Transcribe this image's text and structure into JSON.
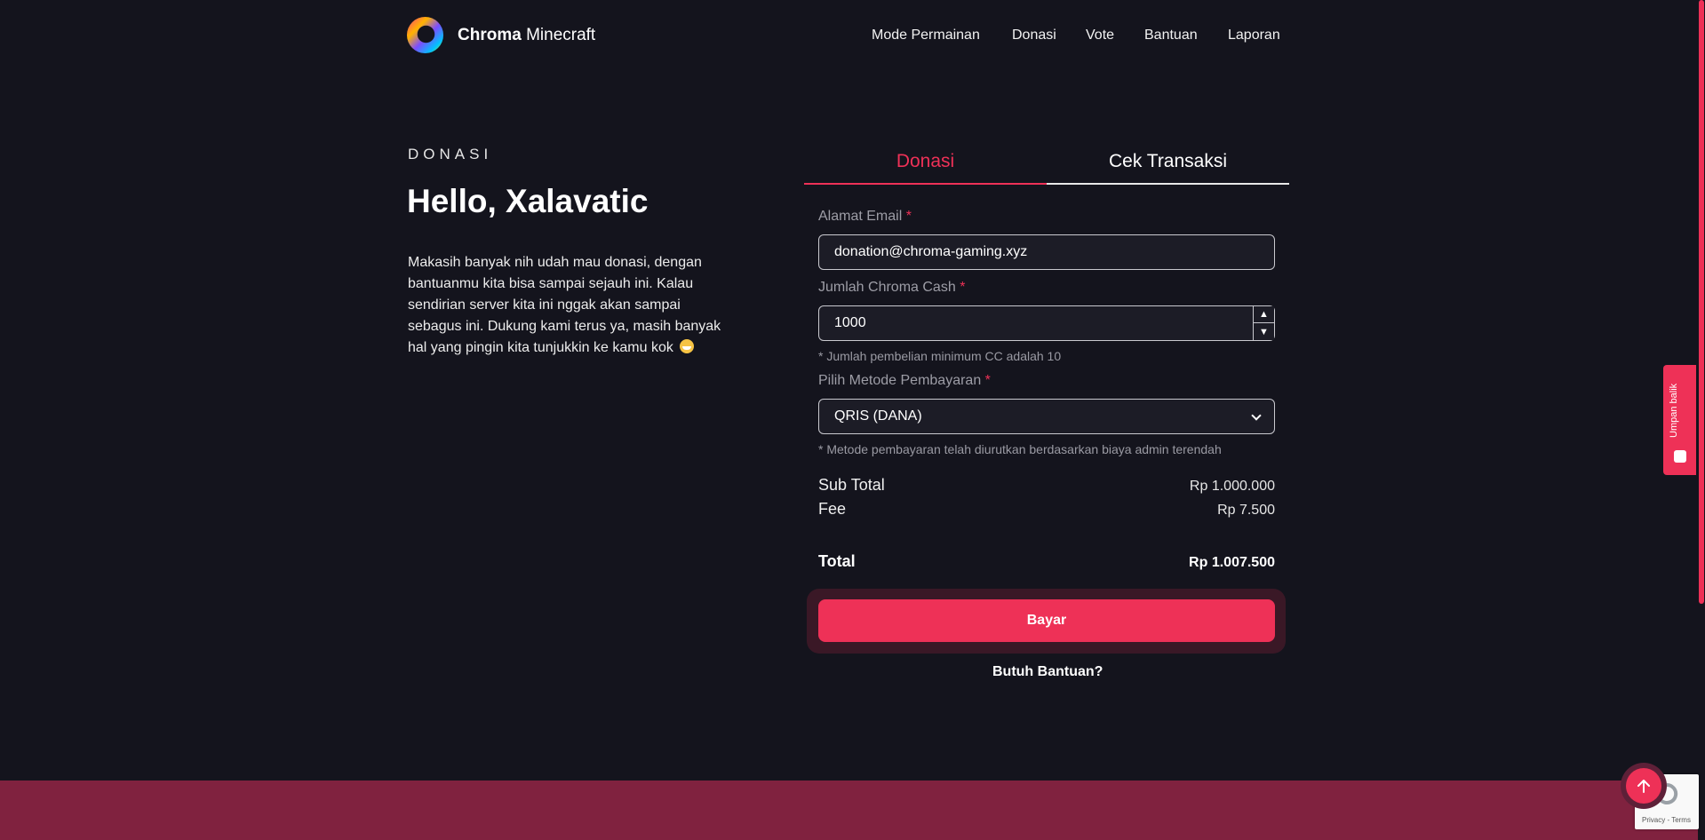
{
  "header": {
    "brand_bold": "Chroma",
    "brand_rest": " Minecraft",
    "nav": [
      "Mode Permainan",
      "Donasi",
      "Vote",
      "Bantuan",
      "Laporan"
    ]
  },
  "intro": {
    "eyebrow": "DONASI",
    "greeting": "Hello, Xalavatic",
    "body": "Makasih banyak nih udah mau donasi, dengan bantuanmu kita bisa sampai sejauh ini. Kalau sendirian server kita ini nggak akan sampai sebagus ini. Dukung kami terus ya, masih banyak hal yang pingin kita tunjukkin ke kamu kok"
  },
  "tabs": {
    "donasi": "Donasi",
    "cek": "Cek Transaksi"
  },
  "form": {
    "email_label": "Alamat Email",
    "email_value": "donation@chroma-gaming.xyz",
    "cash_label": "Jumlah Chroma Cash",
    "cash_value": "1000",
    "cash_hint": "* Jumlah pembelian minimum CC adalah 10",
    "method_label": "Pilih Metode Pembayaran",
    "method_value": "QRIS (DANA)",
    "method_hint": "* Metode pembayaran telah diurutkan berdasarkan biaya admin terendah",
    "required_mark": "*"
  },
  "summary": {
    "subtotal_label": "Sub Total",
    "subtotal_value": "Rp 1.000.000",
    "fee_label": "Fee",
    "fee_value": "Rp 7.500",
    "total_label": "Total",
    "total_value": "Rp 1.007.500"
  },
  "actions": {
    "pay": "Bayar",
    "help": "Butuh Bantuan?"
  },
  "widgets": {
    "feedback": "Umpan balik",
    "recaptcha_text": "Privacy - Terms"
  },
  "colors": {
    "background": "#14141d",
    "accent": "#ee3157",
    "footer": "#80223f"
  }
}
